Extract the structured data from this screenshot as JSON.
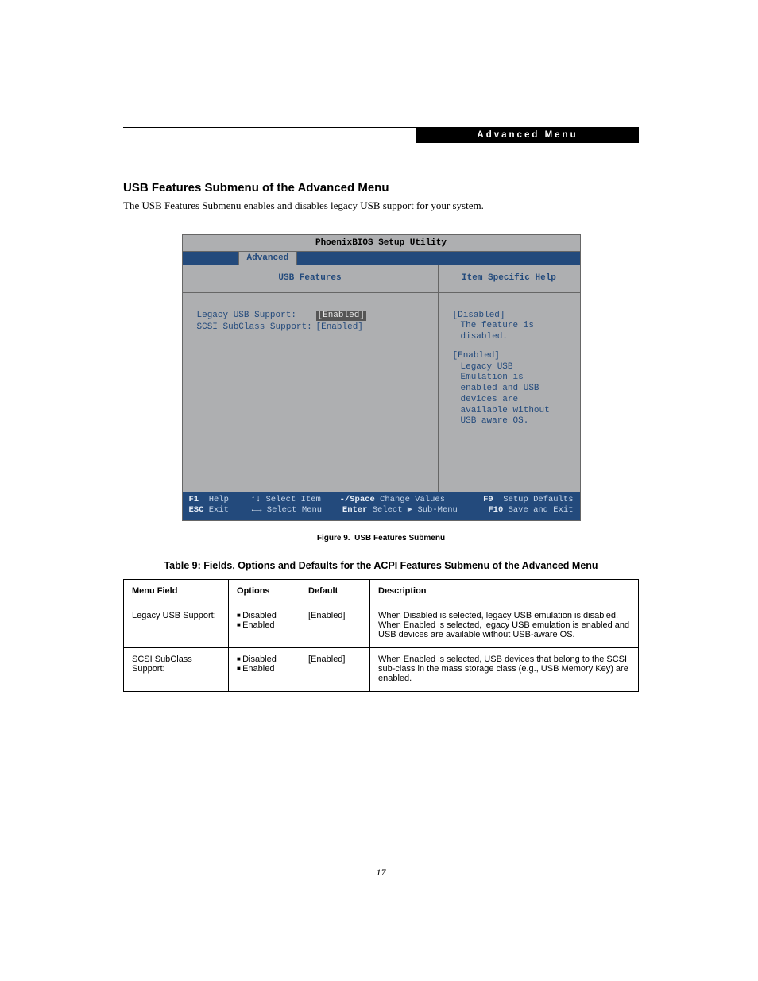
{
  "header": {
    "banner": "Advanced Menu"
  },
  "section": {
    "title": "USB Features Submenu of the Advanced Menu",
    "intro": "The USB Features Submenu enables and disables legacy USB support for your system."
  },
  "bios": {
    "title": "PhoenixBIOS Setup Utility",
    "tab": "Advanced",
    "left_heading": "USB Features",
    "right_heading": "Item Specific Help",
    "settings": [
      {
        "label": "Legacy USB Support:",
        "value": "[Enabled]",
        "highlight": true
      },
      {
        "label": "SCSI SubClass Support:",
        "value": "[Enabled]",
        "highlight": false
      }
    ],
    "help": {
      "disabled_label": "[Disabled]",
      "disabled_text": "The feature is disabled.",
      "enabled_label": "[Enabled]",
      "enabled_text": "Legacy USB Emulation is enabled and USB devices are available without USB aware OS."
    },
    "footer": {
      "f1": "F1",
      "help": "Help",
      "updown": "↑↓",
      "select_item": "Select Item",
      "minus_space": "-/Space",
      "change_values": "Change Values",
      "f9": "F9",
      "setup_defaults": "Setup Defaults",
      "esc": "ESC",
      "exit": "Exit",
      "leftright": "←→",
      "select_menu": "Select Menu",
      "enter": "Enter",
      "select_sub": "Select ▶ Sub-Menu",
      "f10": "F10",
      "save_exit": "Save and Exit"
    }
  },
  "figure": {
    "label": "Figure 9.",
    "caption": "USB Features Submenu"
  },
  "table": {
    "title": "Table 9: Fields, Options and Defaults for the ACPI Features Submenu of the Advanced Menu",
    "headers": {
      "menu": "Menu Field",
      "options": "Options",
      "default": "Default",
      "description": "Description"
    },
    "rows": [
      {
        "menu": "Legacy USB Support:",
        "options": [
          "Disabled",
          "Enabled"
        ],
        "default": "[Enabled]",
        "description": "When Disabled is selected, legacy USB emulation is disabled. When Enabled is selected, legacy USB emulation is enabled and USB devices are available without USB-aware OS."
      },
      {
        "menu": "SCSI SubClass Support:",
        "options": [
          "Disabled",
          "Enabled"
        ],
        "default": "[Enabled]",
        "description": "When Enabled is selected, USB devices that belong to the SCSI sub-class in the mass storage class (e.g., USB Memory Key) are enabled."
      }
    ]
  },
  "page_number": "17"
}
